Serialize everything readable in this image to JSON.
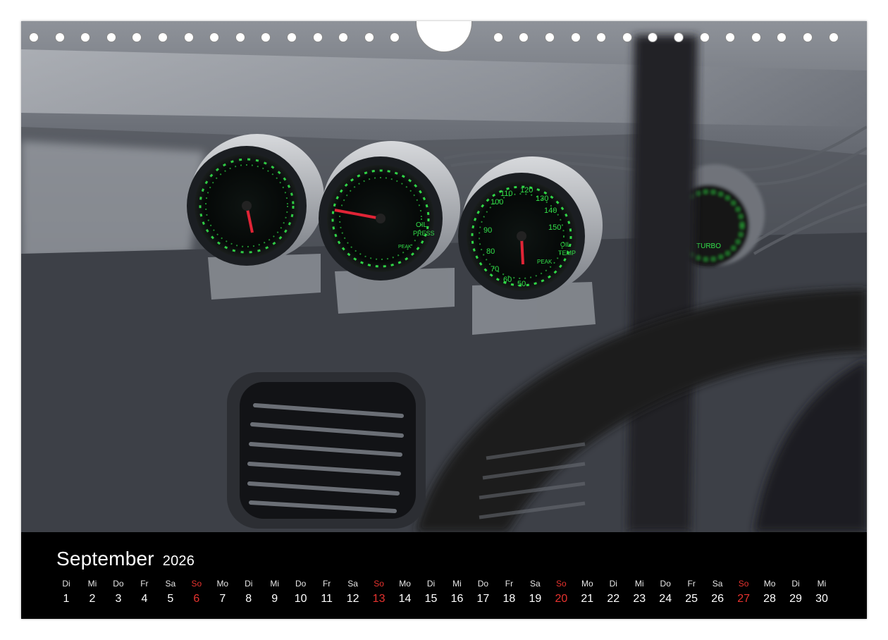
{
  "calendar": {
    "month": "September",
    "year": "2026",
    "sunday_color": "#e8332f",
    "days": [
      {
        "wd": "Di",
        "n": "1"
      },
      {
        "wd": "Mi",
        "n": "2"
      },
      {
        "wd": "Do",
        "n": "3"
      },
      {
        "wd": "Fr",
        "n": "4"
      },
      {
        "wd": "Sa",
        "n": "5"
      },
      {
        "wd": "So",
        "n": "6"
      },
      {
        "wd": "Mo",
        "n": "7"
      },
      {
        "wd": "Di",
        "n": "8"
      },
      {
        "wd": "Mi",
        "n": "9"
      },
      {
        "wd": "Do",
        "n": "10"
      },
      {
        "wd": "Fr",
        "n": "11"
      },
      {
        "wd": "Sa",
        "n": "12"
      },
      {
        "wd": "So",
        "n": "13"
      },
      {
        "wd": "Mo",
        "n": "14"
      },
      {
        "wd": "Di",
        "n": "15"
      },
      {
        "wd": "Mi",
        "n": "16"
      },
      {
        "wd": "Do",
        "n": "17"
      },
      {
        "wd": "Fr",
        "n": "18"
      },
      {
        "wd": "Sa",
        "n": "19"
      },
      {
        "wd": "So",
        "n": "20"
      },
      {
        "wd": "Mo",
        "n": "21"
      },
      {
        "wd": "Di",
        "n": "22"
      },
      {
        "wd": "Mi",
        "n": "23"
      },
      {
        "wd": "Do",
        "n": "24"
      },
      {
        "wd": "Fr",
        "n": "25"
      },
      {
        "wd": "Sa",
        "n": "26"
      },
      {
        "wd": "So",
        "n": "27"
      },
      {
        "wd": "Mo",
        "n": "28"
      },
      {
        "wd": "Di",
        "n": "29"
      },
      {
        "wd": "Mi",
        "n": "30"
      }
    ]
  },
  "photo": {
    "subject": "car-dashboard-gauges",
    "gauge_color": "#33e04a",
    "gauges": [
      {
        "labels": []
      },
      {
        "labels": [
          "OIL",
          "PRESS",
          "PEAK"
        ]
      },
      {
        "labels": [
          "OIL",
          "TEMP",
          "PEAK",
          "110",
          "120",
          "130",
          "140",
          "150",
          "100",
          "90",
          "80",
          "70",
          "60",
          "50"
        ]
      },
      {
        "labels": [
          "TURBO"
        ]
      }
    ]
  }
}
